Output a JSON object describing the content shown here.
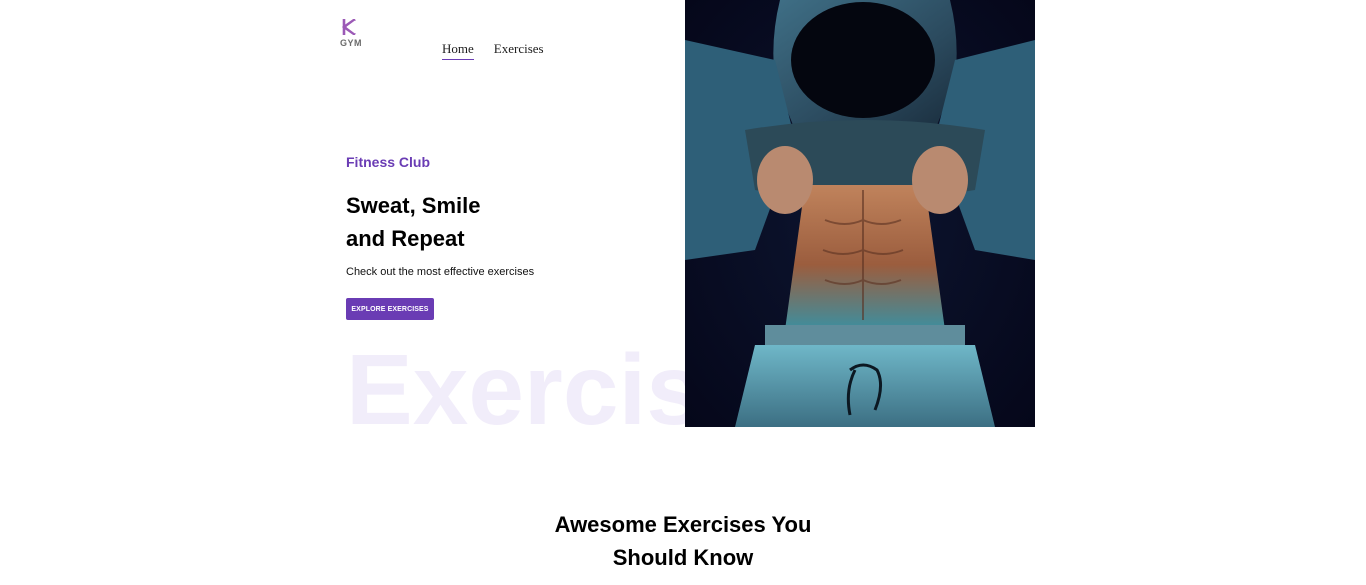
{
  "brand": {
    "logo_letter_icon": "k-logo-icon",
    "logo_text": "GYM",
    "accent_color": "#6a3cb4"
  },
  "nav": {
    "items": [
      {
        "label": "Home",
        "active": true
      },
      {
        "label": "Exercises",
        "active": false
      }
    ]
  },
  "hero": {
    "eyebrow": "Fitness Club",
    "title_line1": "Sweat, Smile",
    "title_line2": "and Repeat",
    "subtitle": "Check out the most effective exercises",
    "cta_label": "EXPLORE EXERCISES",
    "watermark": "Exercise",
    "image_icon": "hooded-athlete-photo"
  },
  "section": {
    "title_line1": "Awesome Exercises You",
    "title_line2": "Should Know"
  }
}
